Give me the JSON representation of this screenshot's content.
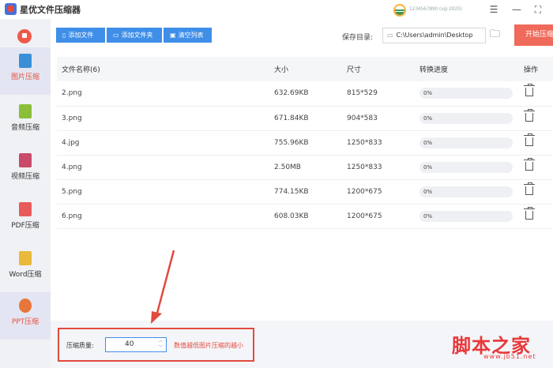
{
  "app": {
    "title": "星优文件压缩器",
    "user_name": "1234567890 (vip 2025)"
  },
  "window_controls": {
    "settings": "☰",
    "minimize": "—",
    "maximize": "⛶"
  },
  "sidebar": {
    "items": [
      {
        "label": "图片压缩",
        "icon": "image-icon",
        "color": "#3a8fd6"
      },
      {
        "label": "音频压缩",
        "icon": "audio-icon",
        "color": "#8bbf3a"
      },
      {
        "label": "视频压缩",
        "icon": "video-icon",
        "color": "#c94a6a"
      },
      {
        "label": "PDF压缩",
        "icon": "pdf-icon",
        "color": "#e85a5a"
      },
      {
        "label": "Word压缩",
        "icon": "word-icon",
        "color": "#e8b93a"
      },
      {
        "label": "PPT压缩",
        "icon": "ppt-icon",
        "color": "#e8763a"
      }
    ]
  },
  "toolbar": {
    "add_file": "添加文件",
    "add_folder": "添加文件夹",
    "clear_list": "清空列表",
    "save_dir_label": "保存目录:",
    "save_path": "C:\\Users\\admin\\Desktop",
    "start": "开始压缩"
  },
  "table": {
    "headers": [
      "文件名称(6)",
      "大小",
      "尺寸",
      "转换进度",
      "操作"
    ],
    "rows": [
      {
        "name": "2.png",
        "size": "632.69KB",
        "dim": "815*529",
        "progress": "0%"
      },
      {
        "name": "3.png",
        "size": "671.84KB",
        "dim": "904*583",
        "progress": "0%"
      },
      {
        "name": "4.jpg",
        "size": "755.96KB",
        "dim": "1250*833",
        "progress": "0%"
      },
      {
        "name": "4.png",
        "size": "2.50MB",
        "dim": "1250*833",
        "progress": "0%"
      },
      {
        "name": "5.png",
        "size": "774.15KB",
        "dim": "1200*675",
        "progress": "0%"
      },
      {
        "name": "6.png",
        "size": "608.03KB",
        "dim": "1200*675",
        "progress": "0%"
      }
    ]
  },
  "quality": {
    "label": "压缩质量:",
    "value": "40",
    "hint": "数值越低图片压缩的越小"
  },
  "watermark": {
    "text": "脚本之家",
    "url": "www.jb51.net"
  },
  "colors": {
    "accent": "#3f8ee8",
    "start": "#ef6a5a",
    "highlight": "#e14a3c"
  }
}
